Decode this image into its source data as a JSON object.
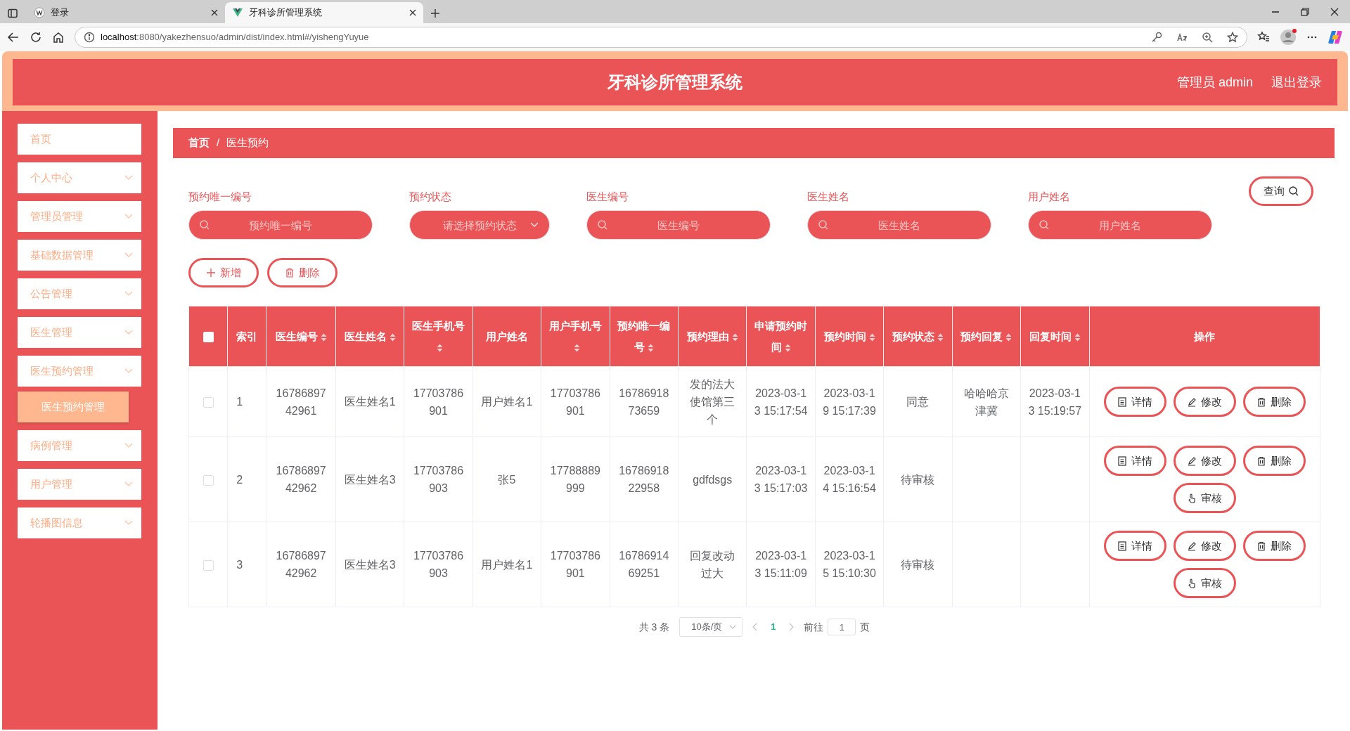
{
  "browser": {
    "tabs": [
      {
        "title": "登录",
        "kind": "letter",
        "selected": false
      },
      {
        "title": "牙科诊所管理系统",
        "kind": "logo",
        "selected": true
      }
    ],
    "url": {
      "host": "localhost",
      "path": ":8080/yakezhensuo/admin/dist/index.html#/yishengYuyue"
    }
  },
  "header": {
    "title": "牙科诊所管理系统",
    "user": "管理员 admin",
    "logout": "退出登录"
  },
  "sidebar": {
    "items": [
      {
        "label": "首页",
        "expandable": false
      },
      {
        "label": "个人中心",
        "expandable": true
      },
      {
        "label": "管理员管理",
        "expandable": true
      },
      {
        "label": "基础数据管理",
        "expandable": true
      },
      {
        "label": "公告管理",
        "expandable": true
      },
      {
        "label": "医生管理",
        "expandable": true
      },
      {
        "label": "医生预约管理",
        "expandable": true,
        "children": [
          {
            "label": "医生预约管理",
            "selected": true
          }
        ]
      },
      {
        "label": "病例管理",
        "expandable": true
      },
      {
        "label": "用户管理",
        "expandable": true
      },
      {
        "label": "轮播图信息",
        "expandable": true
      }
    ]
  },
  "breadcrumb": [
    {
      "label": "首页"
    },
    {
      "label": "医生预约"
    }
  ],
  "breadcrumb_separator": "/",
  "search": {
    "fields": [
      {
        "label": "预约唯一编号",
        "kind": "text",
        "placeholder": "预约唯一编号"
      },
      {
        "label": "预约状态",
        "kind": "select",
        "placeholder": "请选择预约状态"
      },
      {
        "label": "医生编号",
        "kind": "text",
        "placeholder": "医生编号"
      },
      {
        "label": "医生姓名",
        "kind": "text",
        "placeholder": "医生姓名"
      },
      {
        "label": "用户姓名",
        "kind": "text",
        "placeholder": "用户姓名"
      }
    ],
    "button": "查询"
  },
  "toolbar": [
    {
      "kind": "add",
      "label": "新增"
    },
    {
      "kind": "delete",
      "label": "删除"
    }
  ],
  "table": {
    "all_selected": false,
    "columns": [
      {
        "label": "索引",
        "sortable": false
      },
      {
        "label": "医生编号",
        "sortable": true
      },
      {
        "label": "医生姓名",
        "sortable": true
      },
      {
        "label": "医生手机号",
        "sortable": true
      },
      {
        "label": "用户姓名",
        "sortable": false
      },
      {
        "label": "用户手机号",
        "sortable": true
      },
      {
        "label": "预约唯一编号",
        "sortable": true
      },
      {
        "label": "预约理由",
        "sortable": true
      },
      {
        "label": "申请预约时间",
        "sortable": true
      },
      {
        "label": "预约时间",
        "sortable": true
      },
      {
        "label": "预约状态",
        "sortable": true
      },
      {
        "label": "预约回复",
        "sortable": true
      },
      {
        "label": "回复时间",
        "sortable": true
      },
      {
        "label": "操作",
        "sortable": false
      }
    ],
    "rows": [
      {
        "selected": false,
        "cells": [
          "1",
          "1678689742961",
          "医生姓名1",
          "17703786901",
          "用户姓名1",
          "17703786901",
          "1678691873659",
          "发的法大使馆第三个",
          "2023-03-13 15:17:54",
          "2023-03-19 15:17:39",
          "同意",
          "哈哈哈京津冀",
          "2023-03-13 15:19:57"
        ],
        "actions": [
          {
            "kind": "detail",
            "label": "详情"
          },
          {
            "kind": "edit",
            "label": "修改"
          },
          {
            "kind": "delete",
            "label": "删除"
          }
        ]
      },
      {
        "selected": false,
        "cells": [
          "2",
          "1678689742962",
          "医生姓名3",
          "17703786903",
          "张5",
          "17788889999",
          "1678691822958",
          "gdfdsgs",
          "2023-03-13 15:17:03",
          "2023-03-14 15:16:54",
          "待审核",
          null,
          null
        ],
        "actions": [
          {
            "kind": "detail",
            "label": "详情"
          },
          {
            "kind": "edit",
            "label": "修改"
          },
          {
            "kind": "delete",
            "label": "删除"
          },
          {
            "kind": "review",
            "label": "审核"
          }
        ]
      },
      {
        "selected": false,
        "cells": [
          "3",
          "1678689742962",
          "医生姓名3",
          "17703786903",
          "用户姓名1",
          "17703786901",
          "1678691469251",
          "回复改动过大",
          "2023-03-13 15:11:09",
          "2023-03-15 15:10:30",
          "待审核",
          null,
          null
        ],
        "actions": [
          {
            "kind": "detail",
            "label": "详情"
          },
          {
            "kind": "edit",
            "label": "修改"
          },
          {
            "kind": "delete",
            "label": "删除"
          },
          {
            "kind": "review",
            "label": "审核"
          }
        ]
      }
    ]
  },
  "pagination": {
    "total": "共 3 条",
    "page_size": "10条/页",
    "pages": [
      {
        "label": "1",
        "selected": true
      }
    ],
    "goto_label": "前往",
    "goto_value": "1",
    "goto_suffix": "页"
  }
}
